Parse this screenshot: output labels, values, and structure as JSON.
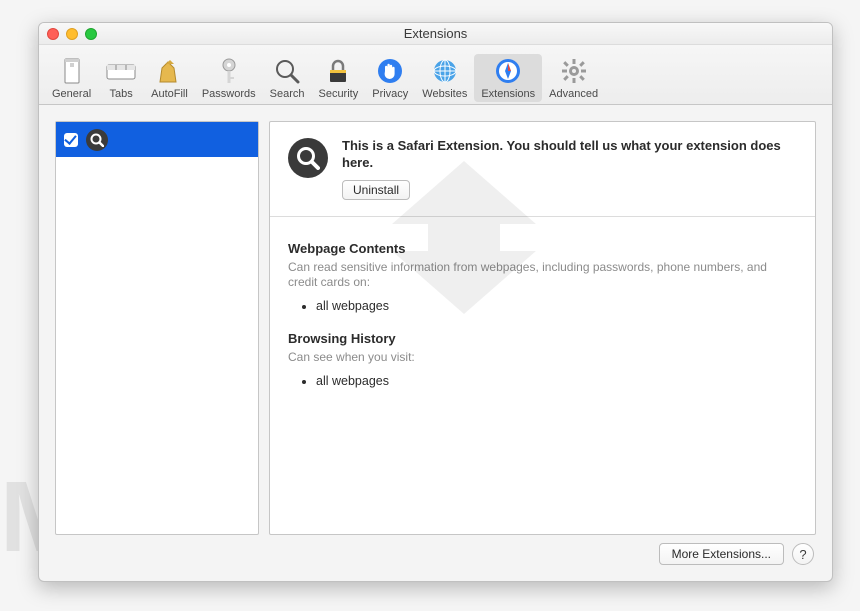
{
  "title": "Extensions",
  "toolbar": [
    {
      "key": "general",
      "label": "General"
    },
    {
      "key": "tabs",
      "label": "Tabs"
    },
    {
      "key": "autofill",
      "label": "AutoFill"
    },
    {
      "key": "passwords",
      "label": "Passwords"
    },
    {
      "key": "search",
      "label": "Search"
    },
    {
      "key": "security",
      "label": "Security"
    },
    {
      "key": "privacy",
      "label": "Privacy"
    },
    {
      "key": "websites",
      "label": "Websites"
    },
    {
      "key": "extensions",
      "label": "Extensions"
    },
    {
      "key": "advanced",
      "label": "Advanced"
    }
  ],
  "toolbar_active": "extensions",
  "sidebar": {
    "items": [
      {
        "icon": "search-icon",
        "checked": true
      }
    ]
  },
  "detail": {
    "description": "This is a Safari Extension. You should tell us what your extension does here.",
    "uninstall_label": "Uninstall",
    "permissions": [
      {
        "title": "Webpage Contents",
        "subtitle": "Can read sensitive information from webpages, including passwords, phone numbers, and credit cards on:",
        "items": [
          "all webpages"
        ]
      },
      {
        "title": "Browsing History",
        "subtitle": "Can see when you visit:",
        "items": [
          "all webpages"
        ]
      }
    ]
  },
  "footer": {
    "more_label": "More Extensions...",
    "help_label": "?"
  },
  "watermark": "MALWARETIPS"
}
